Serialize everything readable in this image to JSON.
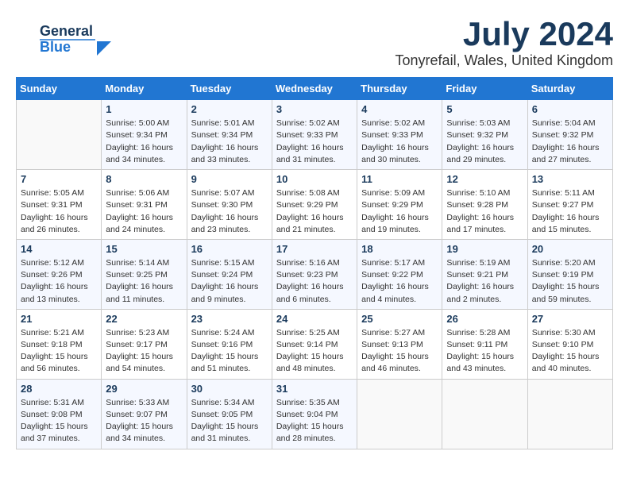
{
  "header": {
    "logo_line1": "General",
    "logo_line2": "Blue",
    "month": "July 2024",
    "location": "Tonyrefail, Wales, United Kingdom"
  },
  "days_of_week": [
    "Sunday",
    "Monday",
    "Tuesday",
    "Wednesday",
    "Thursday",
    "Friday",
    "Saturday"
  ],
  "weeks": [
    [
      {
        "day": "",
        "info": ""
      },
      {
        "day": "1",
        "info": "Sunrise: 5:00 AM\nSunset: 9:34 PM\nDaylight: 16 hours\nand 34 minutes."
      },
      {
        "day": "2",
        "info": "Sunrise: 5:01 AM\nSunset: 9:34 PM\nDaylight: 16 hours\nand 33 minutes."
      },
      {
        "day": "3",
        "info": "Sunrise: 5:02 AM\nSunset: 9:33 PM\nDaylight: 16 hours\nand 31 minutes."
      },
      {
        "day": "4",
        "info": "Sunrise: 5:02 AM\nSunset: 9:33 PM\nDaylight: 16 hours\nand 30 minutes."
      },
      {
        "day": "5",
        "info": "Sunrise: 5:03 AM\nSunset: 9:32 PM\nDaylight: 16 hours\nand 29 minutes."
      },
      {
        "day": "6",
        "info": "Sunrise: 5:04 AM\nSunset: 9:32 PM\nDaylight: 16 hours\nand 27 minutes."
      }
    ],
    [
      {
        "day": "7",
        "info": "Sunrise: 5:05 AM\nSunset: 9:31 PM\nDaylight: 16 hours\nand 26 minutes."
      },
      {
        "day": "8",
        "info": "Sunrise: 5:06 AM\nSunset: 9:31 PM\nDaylight: 16 hours\nand 24 minutes."
      },
      {
        "day": "9",
        "info": "Sunrise: 5:07 AM\nSunset: 9:30 PM\nDaylight: 16 hours\nand 23 minutes."
      },
      {
        "day": "10",
        "info": "Sunrise: 5:08 AM\nSunset: 9:29 PM\nDaylight: 16 hours\nand 21 minutes."
      },
      {
        "day": "11",
        "info": "Sunrise: 5:09 AM\nSunset: 9:29 PM\nDaylight: 16 hours\nand 19 minutes."
      },
      {
        "day": "12",
        "info": "Sunrise: 5:10 AM\nSunset: 9:28 PM\nDaylight: 16 hours\nand 17 minutes."
      },
      {
        "day": "13",
        "info": "Sunrise: 5:11 AM\nSunset: 9:27 PM\nDaylight: 16 hours\nand 15 minutes."
      }
    ],
    [
      {
        "day": "14",
        "info": "Sunrise: 5:12 AM\nSunset: 9:26 PM\nDaylight: 16 hours\nand 13 minutes."
      },
      {
        "day": "15",
        "info": "Sunrise: 5:14 AM\nSunset: 9:25 PM\nDaylight: 16 hours\nand 11 minutes."
      },
      {
        "day": "16",
        "info": "Sunrise: 5:15 AM\nSunset: 9:24 PM\nDaylight: 16 hours\nand 9 minutes."
      },
      {
        "day": "17",
        "info": "Sunrise: 5:16 AM\nSunset: 9:23 PM\nDaylight: 16 hours\nand 6 minutes."
      },
      {
        "day": "18",
        "info": "Sunrise: 5:17 AM\nSunset: 9:22 PM\nDaylight: 16 hours\nand 4 minutes."
      },
      {
        "day": "19",
        "info": "Sunrise: 5:19 AM\nSunset: 9:21 PM\nDaylight: 16 hours\nand 2 minutes."
      },
      {
        "day": "20",
        "info": "Sunrise: 5:20 AM\nSunset: 9:19 PM\nDaylight: 15 hours\nand 59 minutes."
      }
    ],
    [
      {
        "day": "21",
        "info": "Sunrise: 5:21 AM\nSunset: 9:18 PM\nDaylight: 15 hours\nand 56 minutes."
      },
      {
        "day": "22",
        "info": "Sunrise: 5:23 AM\nSunset: 9:17 PM\nDaylight: 15 hours\nand 54 minutes."
      },
      {
        "day": "23",
        "info": "Sunrise: 5:24 AM\nSunset: 9:16 PM\nDaylight: 15 hours\nand 51 minutes."
      },
      {
        "day": "24",
        "info": "Sunrise: 5:25 AM\nSunset: 9:14 PM\nDaylight: 15 hours\nand 48 minutes."
      },
      {
        "day": "25",
        "info": "Sunrise: 5:27 AM\nSunset: 9:13 PM\nDaylight: 15 hours\nand 46 minutes."
      },
      {
        "day": "26",
        "info": "Sunrise: 5:28 AM\nSunset: 9:11 PM\nDaylight: 15 hours\nand 43 minutes."
      },
      {
        "day": "27",
        "info": "Sunrise: 5:30 AM\nSunset: 9:10 PM\nDaylight: 15 hours\nand 40 minutes."
      }
    ],
    [
      {
        "day": "28",
        "info": "Sunrise: 5:31 AM\nSunset: 9:08 PM\nDaylight: 15 hours\nand 37 minutes."
      },
      {
        "day": "29",
        "info": "Sunrise: 5:33 AM\nSunset: 9:07 PM\nDaylight: 15 hours\nand 34 minutes."
      },
      {
        "day": "30",
        "info": "Sunrise: 5:34 AM\nSunset: 9:05 PM\nDaylight: 15 hours\nand 31 minutes."
      },
      {
        "day": "31",
        "info": "Sunrise: 5:35 AM\nSunset: 9:04 PM\nDaylight: 15 hours\nand 28 minutes."
      },
      {
        "day": "",
        "info": ""
      },
      {
        "day": "",
        "info": ""
      },
      {
        "day": "",
        "info": ""
      }
    ]
  ]
}
